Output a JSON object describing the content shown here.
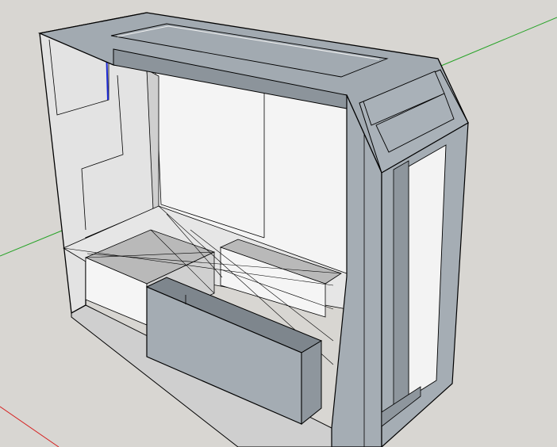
{
  "app": {
    "view": "3d-model-viewport"
  },
  "colors": {
    "background": "#d8d6d2",
    "face_light": "#f3f3f3",
    "face_mid": "#dadada",
    "face_shade": "#a7afb6",
    "face_dark": "#8e969d",
    "face_darker": "#7b8289",
    "edge": "#000000",
    "axis_red": "#d62020",
    "axis_green": "#27a327",
    "axis_blue": "#1f2bd6"
  },
  "axes": {
    "red": "red-axis",
    "green": "green-axis",
    "blue": "blue-axis"
  }
}
